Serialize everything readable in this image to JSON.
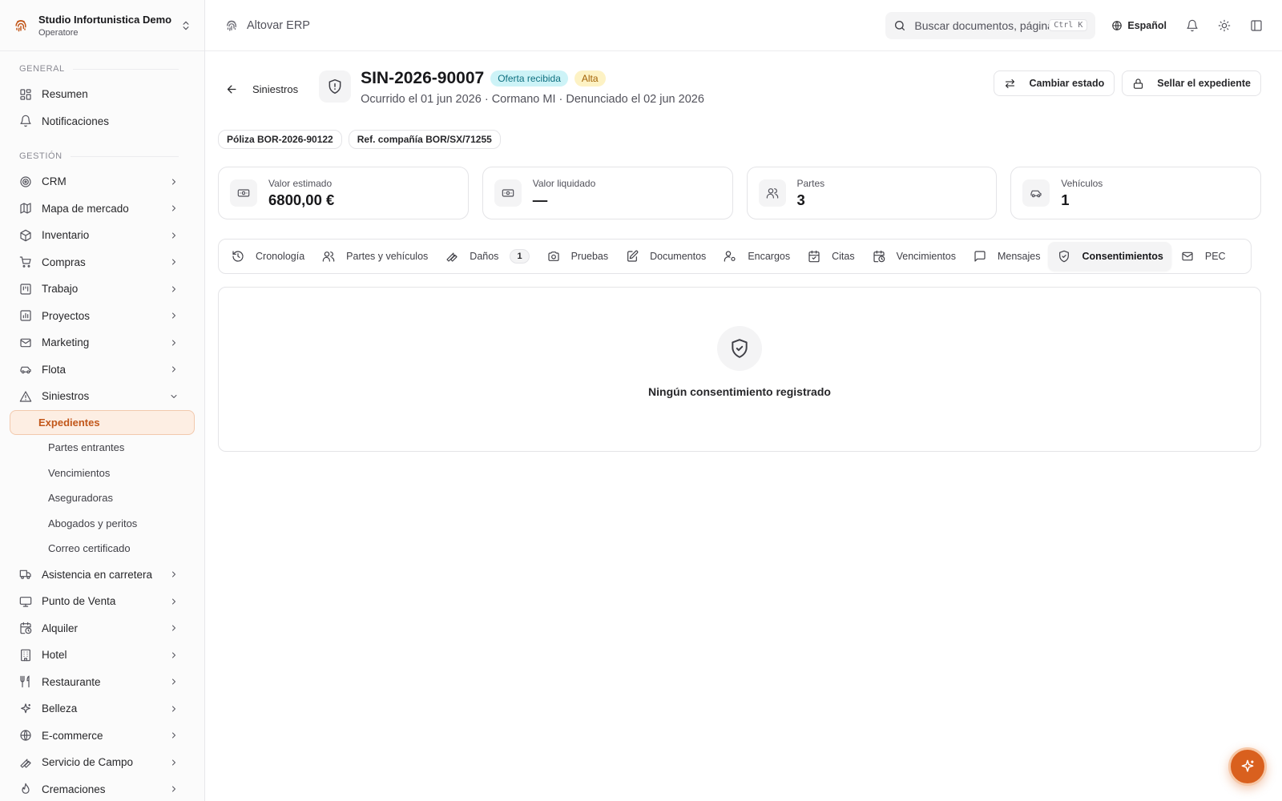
{
  "org": {
    "name": "Studio Infortunistica Demo",
    "role": "Operatore"
  },
  "topbar": {
    "brand": "Altovar ERP",
    "search_placeholder": "Buscar documentos, páginas...",
    "shortcut": "Ctrl K",
    "language": "Español"
  },
  "sidebar": {
    "section_general": "GENERAL",
    "general_items": [
      {
        "label": "Resumen",
        "icon": "dashboard-icon"
      },
      {
        "label": "Notificaciones",
        "icon": "bell-icon"
      }
    ],
    "section_gestion": "GESTIÓN",
    "gestion_items": [
      {
        "label": "CRM",
        "icon": "target-icon"
      },
      {
        "label": "Mapa de mercado",
        "icon": "map-icon"
      },
      {
        "label": "Inventario",
        "icon": "package-icon"
      },
      {
        "label": "Compras",
        "icon": "cart-icon"
      },
      {
        "label": "Trabajo",
        "icon": "kanban-icon"
      },
      {
        "label": "Proyectos",
        "icon": "chart-icon"
      },
      {
        "label": "Marketing",
        "icon": "mail-icon"
      },
      {
        "label": "Flota",
        "icon": "car-icon"
      }
    ],
    "siniestros": {
      "label": "Siniestros",
      "sub_items": [
        "Expedientes",
        "Partes entrantes",
        "Vencimientos",
        "Aseguradoras",
        "Abogados y peritos",
        "Correo certificado"
      ]
    },
    "more_items": [
      {
        "label": "Asistencia en carretera",
        "icon": "truck-icon"
      },
      {
        "label": "Punto de Venta",
        "icon": "monitor-icon"
      },
      {
        "label": "Alquiler",
        "icon": "calendar-clock-icon"
      },
      {
        "label": "Hotel",
        "icon": "building-icon"
      },
      {
        "label": "Restaurante",
        "icon": "utensils-icon"
      },
      {
        "label": "Belleza",
        "icon": "sparkle-icon"
      },
      {
        "label": "E-commerce",
        "icon": "globe-icon"
      },
      {
        "label": "Servicio de Campo",
        "icon": "wrench-icon"
      },
      {
        "label": "Cremaciones",
        "icon": "flame-icon"
      }
    ]
  },
  "header": {
    "back_label": "Siniestros",
    "case_id": "SIN-2026-90007",
    "status_badge": "Oferta recibida",
    "priority_badge": "Alta",
    "subtitle": "Ocurrido el 01 jun 2026 · Cormano MI · Denunciado el 02 jun 2026",
    "change_status_label": "Cambiar estado",
    "seal_label": "Sellar el expediente",
    "colors": {
      "status_bg": "#cdf3f7",
      "status_fg": "#0e7080",
      "priority_bg": "#fdf2c4",
      "priority_fg": "#a36206",
      "accent": "#d9601e"
    }
  },
  "chips": [
    "Póliza BOR-2026-90122",
    "Ref. compañía BOR/SX/71255"
  ],
  "stats": [
    {
      "label": "Valor estimado",
      "value": "6800,00 €",
      "icon": "banknote-icon"
    },
    {
      "label": "Valor liquidado",
      "value": "—",
      "icon": "banknote-icon"
    },
    {
      "label": "Partes",
      "value": "3",
      "icon": "users-icon"
    },
    {
      "label": "Vehículos",
      "value": "1",
      "icon": "car-icon"
    }
  ],
  "tabs": [
    {
      "label": "Cronología",
      "icon": "history-icon"
    },
    {
      "label": "Partes y vehículos",
      "icon": "users-icon"
    },
    {
      "label": "Daños",
      "icon": "wrench-icon",
      "count": "1"
    },
    {
      "label": "Pruebas",
      "icon": "camera-icon"
    },
    {
      "label": "Documentos",
      "icon": "document-edit-icon"
    },
    {
      "label": "Encargos",
      "icon": "user-cog-icon"
    },
    {
      "label": "Citas",
      "icon": "calendar-icon"
    },
    {
      "label": "Vencimientos",
      "icon": "calendar-clock-icon"
    },
    {
      "label": "Mensajes",
      "icon": "message-icon"
    },
    {
      "label": "Consentimientos",
      "icon": "shield-check-icon",
      "active": true
    },
    {
      "label": "PEC",
      "icon": "mail-icon"
    }
  ],
  "empty_state": {
    "text": "Ningún consentimiento registrado",
    "icon": "shield-check-icon"
  }
}
